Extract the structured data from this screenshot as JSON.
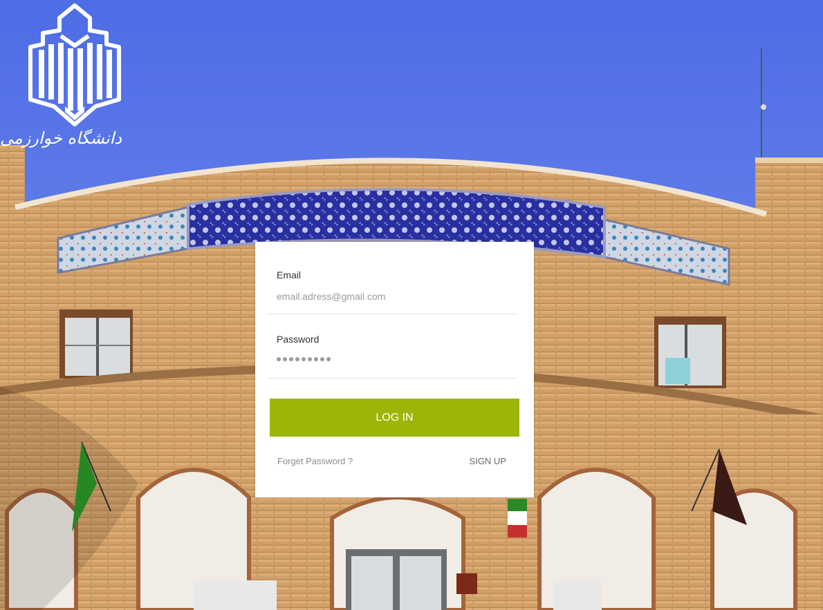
{
  "branding": {
    "logo_text": "دانشگاه خوارزمی",
    "logo_icon": "university-emblem-icon"
  },
  "background": {
    "sky_color": "#5f7ee6",
    "brick_color": "#d6a56a",
    "tile_color": "#2a2fa0"
  },
  "login": {
    "email_label": "Email",
    "email_placeholder": "email.adress@gmail.com",
    "password_label": "Password",
    "password_masked_length": 9,
    "login_button_label": "LOG IN",
    "forget_password_label": "Forget Password  ?",
    "signup_label": "SIGN UP",
    "button_color": "#9db508"
  }
}
